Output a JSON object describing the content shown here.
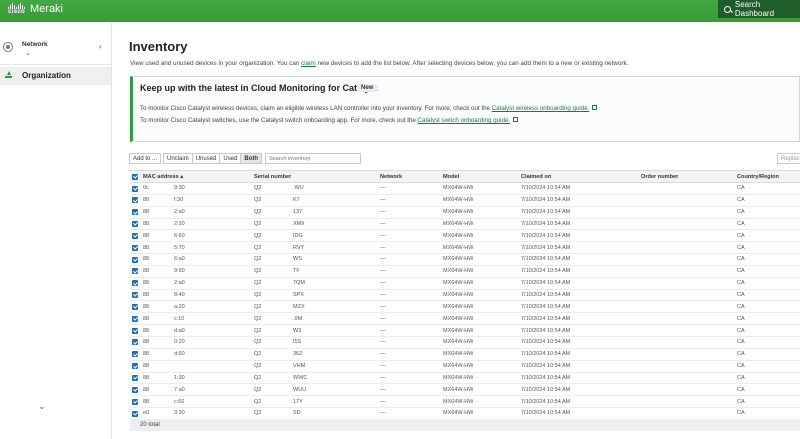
{
  "app": {
    "brand_word": "cisco",
    "brand_name": "Meraki",
    "search_dashboard": "Search Dashboard",
    "accent_color": "#3a9f3a"
  },
  "sidebar": {
    "network_label": "Network",
    "items": [
      {
        "label": "Organization",
        "icon": "download-icon"
      }
    ]
  },
  "page": {
    "title": "Inventory",
    "desc_before": "View used and unused devices in your organization. You can ",
    "desc_link": "claim",
    "desc_after": " new devices to add the list below. After selecting devices below, you can add them to a new or existing network."
  },
  "banner": {
    "title": "Keep up with the latest in Cloud Monitoring for Catalyst",
    "badge": "New",
    "line1_text": "To monitor Cisco Catalyst wireless devices, claim an eligible wireless LAN controller into your inventory. For more, check out the ",
    "line1_link": "Catalyst wireless onboarding guide.",
    "line2_text": "To monitor Cisco Catalyst switches, use the Catalyst switch onboarding app. For more, check out the ",
    "line2_link": "Catalyst switch onboarding guide."
  },
  "toolbar": {
    "add_to": "Add to ...",
    "filters": [
      "Unclaim",
      "Unused",
      "Used",
      "Both"
    ],
    "active_filter": "Both",
    "search_placeholder": "Search inventory",
    "replace": "Replac"
  },
  "table": {
    "columns": [
      "MAC address",
      "Serial number",
      "Network",
      "Model",
      "Claimed on",
      "Order number",
      "Country/Region"
    ],
    "sort_indicator": "▴",
    "rows": [
      {
        "mac_a": "0c",
        "mac_b": "9:30",
        "ser_a": "Q2",
        "ser_b": ".WU",
        "network": "—",
        "model": "MX64W-HW",
        "claimed": "7/10/2024 10:54 AM",
        "order": "",
        "country": "CA"
      },
      {
        "mac_a": "88",
        "mac_b": "f:30",
        "ser_a": "Q2",
        "ser_b": "K7",
        "network": "—",
        "model": "MX64W-HW",
        "claimed": "7/10/2024 10:54 AM",
        "order": "",
        "country": "CA"
      },
      {
        "mac_a": "88",
        "mac_b": "2:a0",
        "ser_a": "Q2",
        "ser_b": "137",
        "network": "—",
        "model": "MX64W-HW",
        "claimed": "7/10/2024 10:54 AM",
        "order": "",
        "country": "CA"
      },
      {
        "mac_a": "88",
        "mac_b": "2:20",
        "ser_a": "Q2",
        "ser_b": "XM9",
        "network": "—",
        "model": "MX64W-HW",
        "claimed": "7/10/2024 10:54 AM",
        "order": "",
        "country": "CA"
      },
      {
        "mac_a": "88",
        "mac_b": "6:60",
        "ser_a": "Q2",
        "ser_b": "IDG",
        "network": "—",
        "model": "MX64W-HW",
        "claimed": "7/10/2024 10:54 AM",
        "order": "",
        "country": "CA"
      },
      {
        "mac_a": "88",
        "mac_b": "5:70",
        "ser_a": "Q2",
        "ser_b": "RVY",
        "network": "—",
        "model": "MX64W-HW",
        "claimed": "7/10/2024 10:54 AM",
        "order": "",
        "country": "CA"
      },
      {
        "mac_a": "88",
        "mac_b": "6:a0",
        "ser_a": "Q2",
        "ser_b": "WS",
        "network": "—",
        "model": "MX64W-HW",
        "claimed": "7/10/2024 10:54 AM",
        "order": "",
        "country": "CA"
      },
      {
        "mac_a": "88",
        "mac_b": "9:60",
        "ser_a": "Q2",
        "ser_b": "TF",
        "network": "—",
        "model": "MX64W-HW",
        "claimed": "7/10/2024 10:54 AM",
        "order": "",
        "country": "CA"
      },
      {
        "mac_a": "88",
        "mac_b": "2:a0",
        "ser_a": "Q2",
        "ser_b": "7QM",
        "network": "—",
        "model": "MX64W-HW",
        "claimed": "7/10/2024 10:54 AM",
        "order": "",
        "country": "CA"
      },
      {
        "mac_a": "88",
        "mac_b": "8:40",
        "ser_a": "Q2",
        "ser_b": "SPX",
        "network": "—",
        "model": "MX64W-HW",
        "claimed": "7/10/2024 10:54 AM",
        "order": "",
        "country": "CA"
      },
      {
        "mac_a": "88",
        "mac_b": "a:20",
        "ser_a": "Q2",
        "ser_b": "MZX",
        "network": "—",
        "model": "MX64W-HW",
        "claimed": "7/10/2024 10:54 AM",
        "order": "",
        "country": "CA"
      },
      {
        "mac_a": "88",
        "mac_b": "c:10",
        "ser_a": "Q2",
        "ser_b": ".9M",
        "network": "—",
        "model": "MX64W-HW",
        "claimed": "7/10/2024 10:54 AM",
        "order": "",
        "country": "CA"
      },
      {
        "mac_a": "88",
        "mac_b": "d:a0",
        "ser_a": "Q2",
        "ser_b": "W3",
        "network": "—",
        "model": "MX64W-HW",
        "claimed": "7/10/2024 10:54 AM",
        "order": "",
        "country": "CA"
      },
      {
        "mac_a": "88",
        "mac_b": "0:20",
        "ser_a": "Q2",
        "ser_b": "I5S",
        "network": "—",
        "model": "MX64W-HW",
        "claimed": "7/10/2024 10:54 AM",
        "order": "",
        "country": "CA"
      },
      {
        "mac_a": "88",
        "mac_b": "d:60",
        "ser_a": "Q2",
        "ser_b": "36Z",
        "network": "—",
        "model": "MX64W-HW",
        "claimed": "7/10/2024 10:54 AM",
        "order": "",
        "country": "CA"
      },
      {
        "mac_a": "88",
        "mac_b": "",
        "ser_a": "Q2",
        "ser_b": "VHM",
        "network": "—",
        "model": "MX64W-HW",
        "claimed": "7/10/2024 10:54 AM",
        "order": "",
        "country": "CA"
      },
      {
        "mac_a": "88",
        "mac_b": "1:30",
        "ser_a": "Q2",
        "ser_b": "WWC",
        "network": "—",
        "model": "MX64W-HW",
        "claimed": "7/10/2024 10:54 AM",
        "order": "",
        "country": "CA"
      },
      {
        "mac_a": "88",
        "mac_b": "7:a0",
        "ser_a": "Q2",
        "ser_b": "WUU",
        "network": "—",
        "model": "MX64W-HW",
        "claimed": "7/10/2024 10:54 AM",
        "order": "",
        "country": "CA"
      },
      {
        "mac_a": "88",
        "mac_b": "c:60",
        "ser_a": "Q2",
        "ser_b": "17Y",
        "network": "—",
        "model": "MX64W-HW",
        "claimed": "7/10/2024 10:54 AM",
        "order": "",
        "country": "CA"
      },
      {
        "mac_a": "e0",
        "mac_b": "3:30",
        "ser_a": "Q2",
        "ser_b": "SD",
        "network": "—",
        "model": "MX64W-HW",
        "claimed": "7/10/2024 10:54 AM",
        "order": "",
        "country": "CA"
      }
    ],
    "footer": "20 total"
  }
}
